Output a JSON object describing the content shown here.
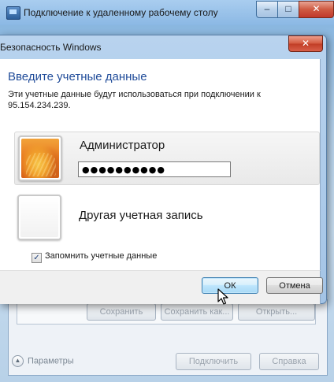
{
  "background_window": {
    "title": "Подключение к удаленному рабочему столу",
    "controls": {
      "minimize": "–",
      "maximize": "□",
      "close": "✕"
    },
    "buttons": {
      "save": "Сохранить",
      "save_as": "Сохранить как...",
      "open": "Открыть..."
    },
    "options_label": "Параметры",
    "options_icon": "chevron-up-icon",
    "connect": "Подключить",
    "help": "Справка"
  },
  "dialog": {
    "title": "Безопасность Windows",
    "close": "✕",
    "heading": "Введите учетные данные",
    "description": "Эти учетные данные будут использоваться при подключении к 95.154.234.239.",
    "accounts": [
      {
        "name": "Администратор",
        "password_masked": "●●●●●●●●●●",
        "selected": true
      },
      {
        "name": "Другая учетная запись",
        "selected": false
      }
    ],
    "remember": {
      "label": "Запомнить учетные данные",
      "checked": true
    },
    "ok": "ОК",
    "cancel": "Отмена"
  },
  "colors": {
    "heading": "#1f4b99",
    "dialog_frame": "#a4c4e6",
    "close_red": "#c13d26",
    "ok_border": "#3c7fb1"
  }
}
